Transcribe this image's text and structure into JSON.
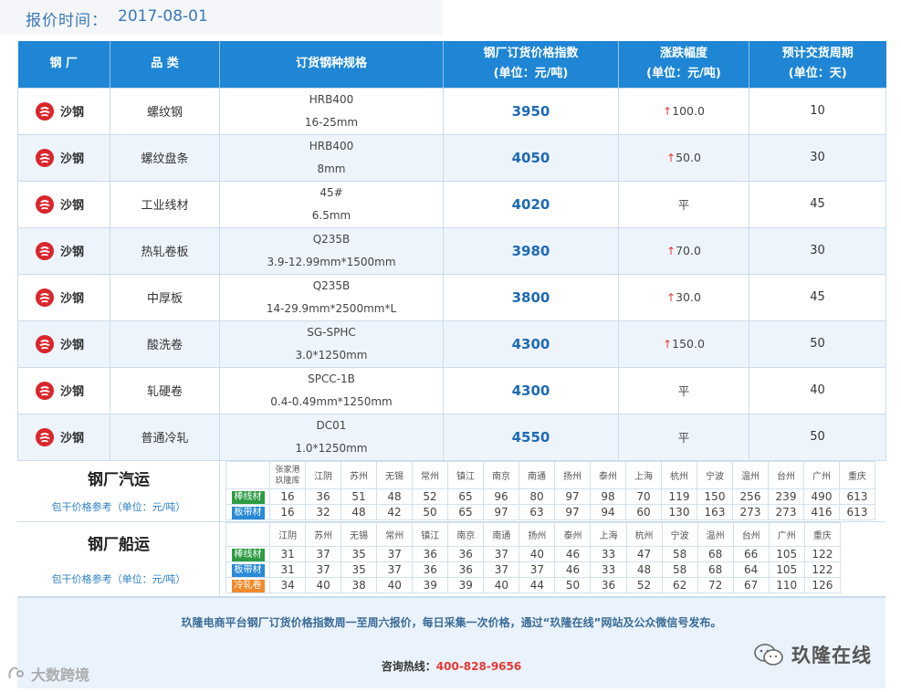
{
  "header": {
    "label": "报价时间：",
    "date": "2017-08-01"
  },
  "columns": {
    "mill": "钢 厂",
    "product": "品 类",
    "spec": "订货钢种规格",
    "price_title": "钢厂订货价格指数",
    "price_unit": "(单位：元/吨)",
    "change_title": "涨跌幅度",
    "change_unit": "(单位：元/吨)",
    "period_title": "预计交货周期",
    "period_unit": "(单位：天)"
  },
  "rows": [
    {
      "mill": "沙钢",
      "product": "螺纹钢",
      "spec1": "HRB400",
      "spec2": "16-25mm",
      "price": "3950",
      "arrow": "↑",
      "change": "100.0",
      "period": "10"
    },
    {
      "mill": "沙钢",
      "product": "螺纹盘条",
      "spec1": "HRB400",
      "spec2": "8mm",
      "price": "4050",
      "arrow": "↑",
      "change": "50.0",
      "period": "30"
    },
    {
      "mill": "沙钢",
      "product": "工业线材",
      "spec1": "45#",
      "spec2": "6.5mm",
      "price": "4020",
      "arrow": "",
      "change": "平",
      "period": "45"
    },
    {
      "mill": "沙钢",
      "product": "热轧卷板",
      "spec1": "Q235B",
      "spec2": "3.9-12.99mm*1500mm",
      "price": "3980",
      "arrow": "↑",
      "change": "70.0",
      "period": "30"
    },
    {
      "mill": "沙钢",
      "product": "中厚板",
      "spec1": "Q235B",
      "spec2": "14-29.9mm*2500mm*L",
      "price": "3800",
      "arrow": "↑",
      "change": "30.0",
      "period": "45"
    },
    {
      "mill": "沙钢",
      "product": "酸洗卷",
      "spec1": "SG-SPHC",
      "spec2": "3.0*1250mm",
      "price": "4300",
      "arrow": "↑",
      "change": "150.0",
      "period": "50"
    },
    {
      "mill": "沙钢",
      "product": "轧硬卷",
      "spec1": "SPCC-1B",
      "spec2": "0.4-0.49mm*1250mm",
      "price": "4300",
      "arrow": "",
      "change": "平",
      "period": "40"
    },
    {
      "mill": "沙钢",
      "product": "普通冷轧",
      "spec1": "DC01",
      "spec2": "1.0*1250mm",
      "price": "4550",
      "arrow": "",
      "change": "平",
      "period": "50"
    }
  ],
  "truck": {
    "title": "钢厂汽运",
    "subtitle": "包干价格参考（单位：元/吨）",
    "cities": [
      "张家港\n玖隆库",
      "江阴",
      "苏州",
      "无锡",
      "常州",
      "镇江",
      "南京",
      "南通",
      "扬州",
      "泰州",
      "上海",
      "杭州",
      "宁波",
      "温州",
      "台州",
      "广州",
      "重庆"
    ],
    "rows": [
      {
        "tag": "棒线材",
        "color": "green",
        "values": [
          "16",
          "36",
          "51",
          "48",
          "52",
          "65",
          "96",
          "80",
          "97",
          "98",
          "70",
          "119",
          "150",
          "256",
          "239",
          "490",
          "613"
        ]
      },
      {
        "tag": "板带材",
        "color": "blue",
        "values": [
          "16",
          "32",
          "48",
          "42",
          "50",
          "65",
          "97",
          "63",
          "97",
          "94",
          "60",
          "130",
          "163",
          "273",
          "273",
          "416",
          "613"
        ]
      }
    ]
  },
  "ship": {
    "title": "钢厂船运",
    "subtitle": "包干价格参考（单位：元/吨）",
    "cities": [
      "江阴",
      "苏州",
      "无锡",
      "常州",
      "镇江",
      "南京",
      "南通",
      "扬州",
      "泰州",
      "上海",
      "杭州",
      "宁波",
      "温州",
      "台州",
      "广州",
      "重庆"
    ],
    "rows": [
      {
        "tag": "棒线材",
        "color": "green",
        "values": [
          "31",
          "37",
          "35",
          "37",
          "36",
          "36",
          "37",
          "40",
          "46",
          "33",
          "47",
          "58",
          "68",
          "66",
          "105",
          "122"
        ]
      },
      {
        "tag": "板带材",
        "color": "blue",
        "values": [
          "31",
          "37",
          "35",
          "37",
          "36",
          "36",
          "37",
          "37",
          "46",
          "33",
          "48",
          "58",
          "68",
          "64",
          "105",
          "122"
        ]
      },
      {
        "tag": "冷轧卷",
        "color": "orange",
        "values": [
          "34",
          "40",
          "38",
          "40",
          "39",
          "39",
          "40",
          "44",
          "50",
          "36",
          "52",
          "62",
          "72",
          "67",
          "110",
          "126"
        ]
      }
    ]
  },
  "footer": {
    "note": "玖隆电商平台钢厂订货价格指数周一至周六报价，每日采集一次价格，通过“玖隆在线”网站及公众微信号发布。",
    "hotline_label": "咨询热线：",
    "hotline_number": "400-828-9656"
  },
  "brand": "玖隆在线",
  "watermark": "大数跨境",
  "colors": {
    "header_blue": "#1e86d4",
    "price_blue": "#1e6ab3",
    "up_red": "#e53935",
    "logo_red": "#d9262c"
  }
}
